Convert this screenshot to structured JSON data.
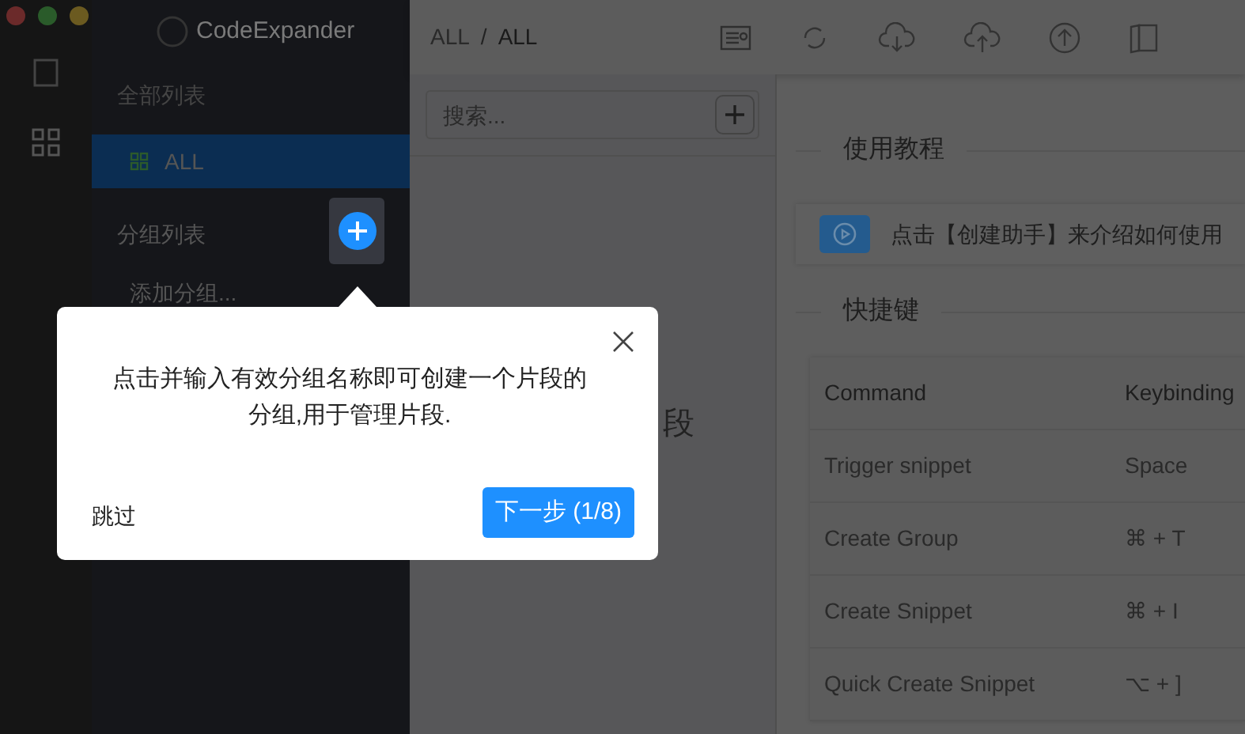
{
  "window": {
    "title": "CodeExpander"
  },
  "sidebar": {
    "section_all": "全部列表",
    "items": [
      {
        "label": "ALL",
        "selected": true
      }
    ],
    "section_groups": "分组列表",
    "add_group": "添加分组..."
  },
  "breadcrumb": {
    "items": [
      "ALL",
      "ALL"
    ],
    "separator": "/"
  },
  "search": {
    "placeholder": "搜索..."
  },
  "empty_hint": "段",
  "tutorial": {
    "heading": "使用教程",
    "text": "点击【创建助手】来介绍如何使用"
  },
  "shortcuts": {
    "heading": "快捷键",
    "columns": [
      "Command",
      "Keybinding"
    ],
    "rows": [
      [
        "Trigger snippet",
        "Space"
      ],
      [
        "Create Group",
        "⌘ + T"
      ],
      [
        "Create Snippet",
        "⌘ + I"
      ],
      [
        "Quick Create Snippet",
        "⌥ + ]"
      ]
    ]
  },
  "guide": {
    "text": "点击并输入有效分组名称即可创建一个片段的分组,用于管理片段.",
    "skip": "跳过",
    "next": "下一步 (1/8)"
  }
}
